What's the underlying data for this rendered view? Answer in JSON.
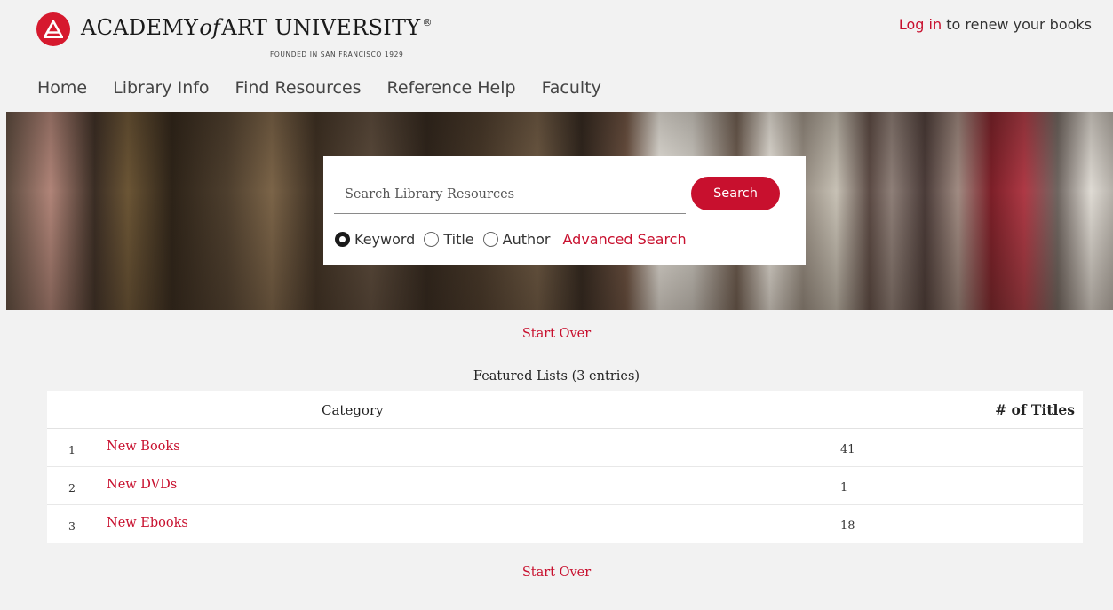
{
  "header": {
    "logo": {
      "name_part1": "ACADEMY",
      "name_of": "of",
      "name_part2": "ART UNIVERSITY",
      "registered": "®",
      "founded": "FOUNDED IN SAN FRANCISCO 1929"
    },
    "login": {
      "link_label": "Log in",
      "suffix": "to renew your books"
    },
    "nav": [
      "Home",
      "Library Info",
      "Find Resources",
      "Reference Help",
      "Faculty"
    ]
  },
  "search": {
    "placeholder": "Search Library Resources",
    "value": "",
    "button_label": "Search",
    "options": [
      {
        "label": "Keyword",
        "checked": true
      },
      {
        "label": "Title",
        "checked": false
      },
      {
        "label": "Author",
        "checked": false
      }
    ],
    "advanced_label": "Advanced Search"
  },
  "start_over_label": "Start Over",
  "featured": {
    "caption": "Featured Lists (3 entries)",
    "columns": {
      "category": "Category",
      "titles": "# of Titles"
    },
    "rows": [
      {
        "index": "1",
        "category": "New Books",
        "count": "41"
      },
      {
        "index": "2",
        "category": "New DVDs",
        "count": "1"
      },
      {
        "index": "3",
        "category": "New Ebooks",
        "count": "18"
      }
    ]
  },
  "colors": {
    "accent": "#c8102e",
    "background": "#f2f2f2"
  }
}
